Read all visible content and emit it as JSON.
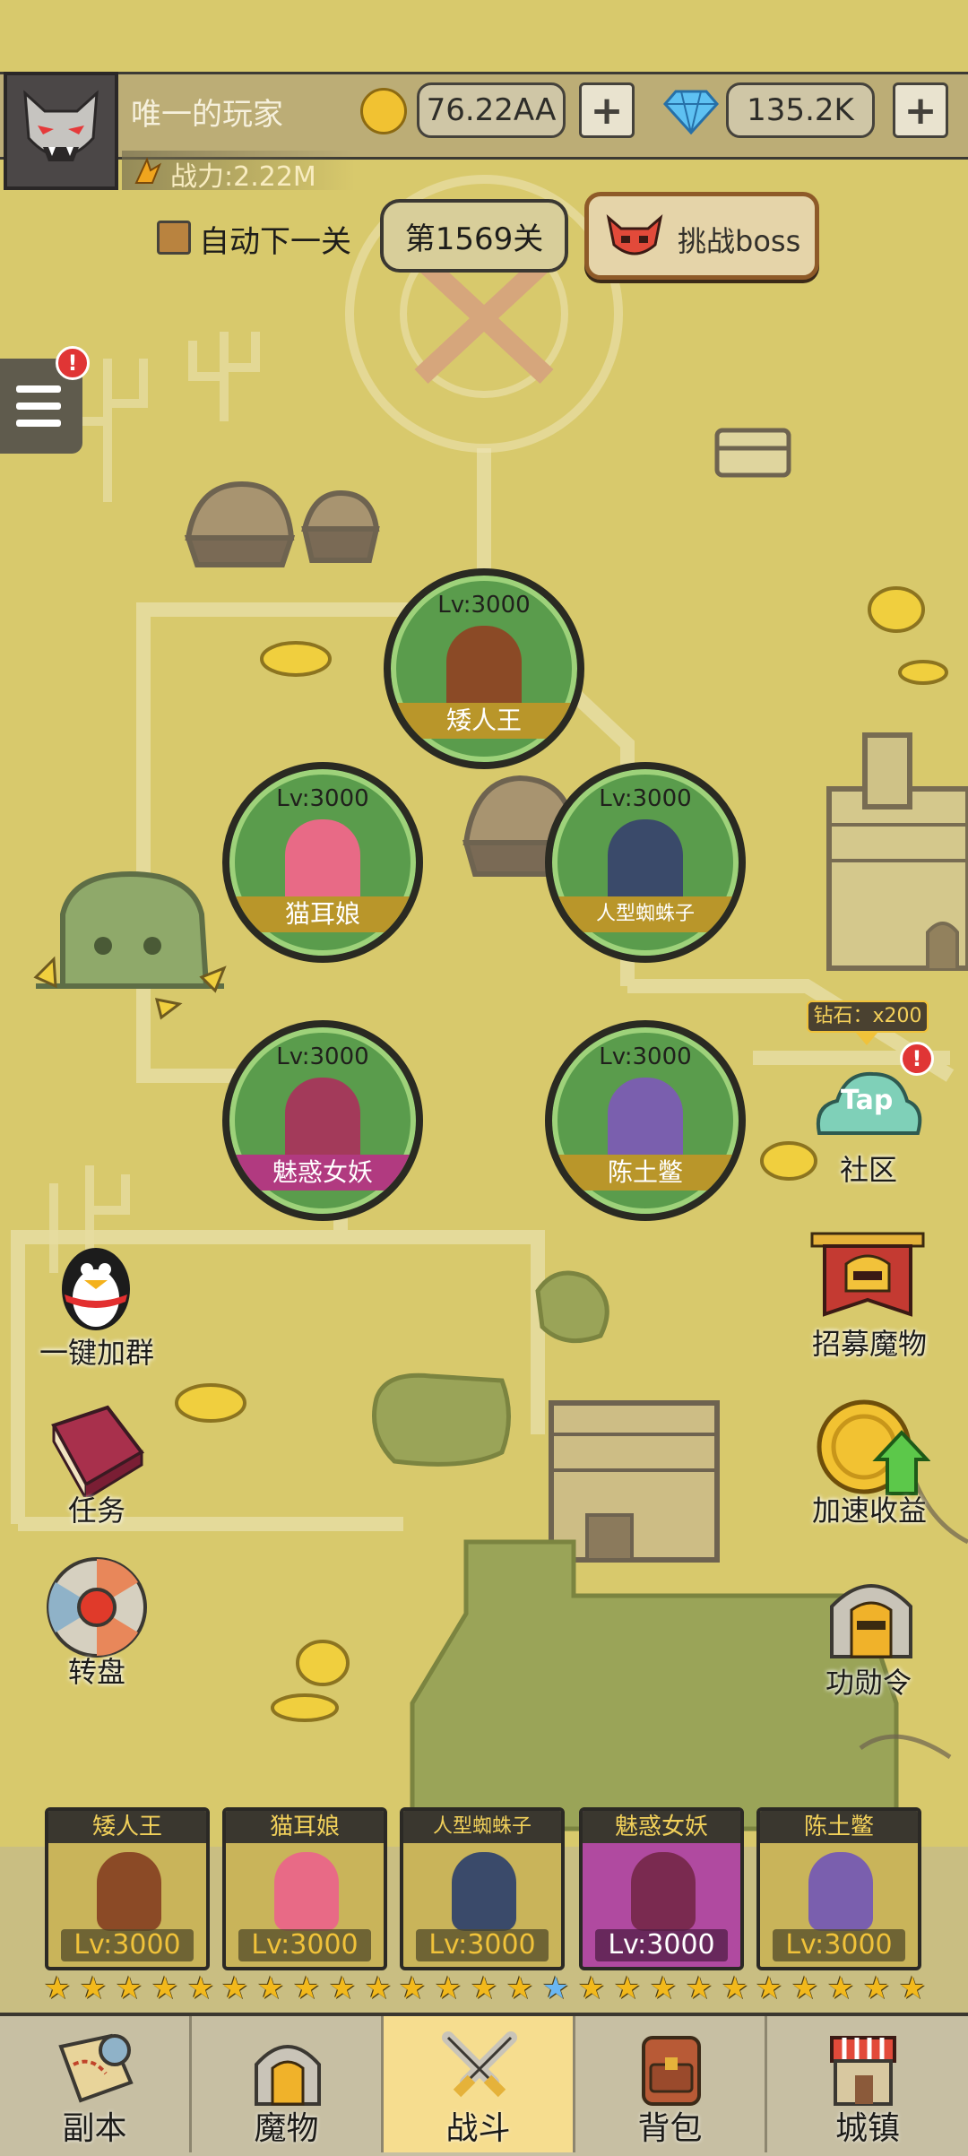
{
  "header": {
    "player_name": "唯一的玩家",
    "gold": "76.22AA",
    "gems": "135.2K",
    "power": "战力:2.22M",
    "plus_symbol": "+"
  },
  "stage": {
    "auto_next_label": "自动下一关",
    "current_stage": "第1569关",
    "challenge_boss_label": "挑战boss"
  },
  "badges": {
    "alert": "!"
  },
  "heroes": [
    {
      "level": "Lv:3000",
      "name": "矮人王"
    },
    {
      "level": "Lv:3000",
      "name": "猫耳娘"
    },
    {
      "level": "Lv:3000",
      "name": "人型蜘蛛子"
    },
    {
      "level": "Lv:3000",
      "name": "魅惑女妖"
    },
    {
      "level": "Lv:3000",
      "name": "陈土鳖"
    }
  ],
  "side_left": {
    "join_group": "一键加群",
    "tasks": "任务",
    "wheel": "转盘"
  },
  "side_right": {
    "diamond_reward": "钻石：x200",
    "tap_label": "Tap",
    "community": "社区",
    "recruit": "招募魔物",
    "speed_income": "加速收益",
    "merit": "功勋令"
  },
  "roster": [
    {
      "name": "矮人王",
      "level": "Lv:3000",
      "stars": 5
    },
    {
      "name": "猫耳娘",
      "level": "Lv:3000",
      "stars": 5
    },
    {
      "name": "人型蜘蛛子",
      "level": "Lv:3000",
      "stars": 5
    },
    {
      "name": "魅惑女妖",
      "level": "Lv:3000",
      "stars": 5
    },
    {
      "name": "陈土鳖",
      "level": "Lv:3000",
      "stars": 5
    }
  ],
  "nav": [
    {
      "label": "副本",
      "active": false
    },
    {
      "label": "魔物",
      "active": false
    },
    {
      "label": "战斗",
      "active": true
    },
    {
      "label": "背包",
      "active": false
    },
    {
      "label": "城镇",
      "active": false
    }
  ],
  "colors": {
    "map_bg": "#d8c96c",
    "hero_green": "#5a9c4c",
    "gold_ribbon": "#b9962a",
    "active_tab": "#f6dd8f"
  }
}
